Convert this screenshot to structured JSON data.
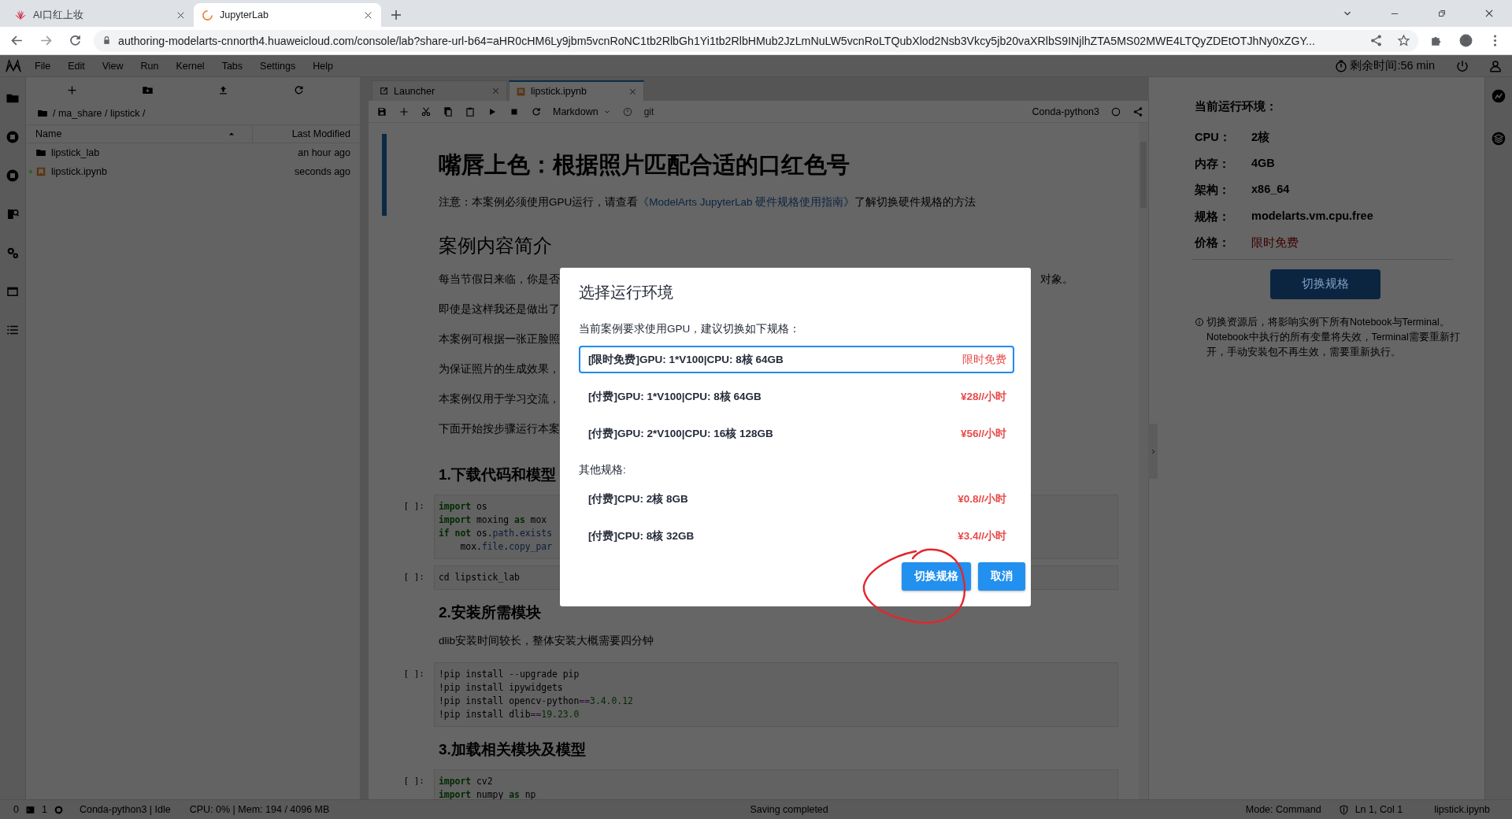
{
  "browser": {
    "tabs": [
      {
        "title": "AI口红上妆",
        "kind": "huawei",
        "selected": false
      },
      {
        "title": "JupyterLab",
        "kind": "loading",
        "selected": true
      }
    ],
    "url": "authoring-modelarts-cnnorth4.huaweicloud.com/console/lab?share-url-b64=aHR0cHM6Ly9jbm5vcnRoNC1tb2RlbGh1Yi1tb2RlbHMub2JzLmNuLW5vcnRoLTQubXlod2Nsb3Vkcy5jb20vaXRlbS9INjlhZTA5MS02MWE4LTQyZDEtOTJhNy0xZGY..."
  },
  "menu": [
    "File",
    "Edit",
    "View",
    "Run",
    "Kernel",
    "Tabs",
    "Settings",
    "Help"
  ],
  "timer": "剩余时间:56 min",
  "file_browser": {
    "path": "/ ma_share / lipstick /",
    "columns": [
      "Name",
      "Last Modified"
    ],
    "files": [
      {
        "name": "lipstick_lab",
        "kind": "folder",
        "modified": "an hour ago",
        "running": false
      },
      {
        "name": "lipstick.ipynb",
        "kind": "notebook",
        "modified": "seconds ago",
        "running": true
      }
    ]
  },
  "notebook": {
    "tabs": [
      {
        "label": "Launcher",
        "kind": "launcher",
        "selected": false
      },
      {
        "label": "lipstick.ipynb",
        "kind": "notebook",
        "selected": true
      }
    ],
    "cell_type": "Markdown",
    "git": "git",
    "kernel": "Conda-python3",
    "cells": [
      {
        "kind": "markdown",
        "active": true,
        "blocks": [
          {
            "kind": "h1",
            "text": "嘴唇上色：根据照片匹配合适的口红色号"
          },
          {
            "kind": "note",
            "text": "注意：本案例必须使用GPU运行，请查看",
            "link": "《ModelArts JupyterLab 硬件规格使用指南》",
            "after": "了解切换硬件规格的方法"
          }
        ]
      },
      {
        "kind": "markdown",
        "active": false,
        "blocks": [
          {
            "kind": "h2",
            "text": "案例内容简介"
          },
          {
            "kind": "p",
            "text": "每当节假日来临，你是否",
            "tail": "对象。"
          },
          {
            "kind": "p",
            "text": "即使是这样我还是做出了"
          },
          {
            "kind": "p",
            "text": "本案例可根据一张正脸照"
          },
          {
            "kind": "p",
            "text": "为保证照片的生成效果，"
          },
          {
            "kind": "p",
            "text": "本案例仅用于学习交流，"
          },
          {
            "kind": "p",
            "text": "下面开始按步骤运行本案"
          },
          {
            "kind": "h3",
            "text": "1.下载代码和模型"
          }
        ]
      },
      {
        "kind": "code",
        "active": false,
        "prompt": "[ ]:",
        "lines": [
          [
            {
              "kind": "keyword",
              "text": "import"
            },
            {
              "text": " os"
            }
          ],
          [
            {
              "kind": "keyword",
              "text": "import"
            },
            {
              "text": " moxing "
            },
            {
              "kind": "keyword",
              "text": "as"
            },
            {
              "text": " mox"
            }
          ],
          [
            {
              "kind": "keyword",
              "text": "if not"
            },
            {
              "text": " os."
            },
            {
              "kind": "attribute",
              "text": "path"
            },
            {
              "text": "."
            },
            {
              "kind": "attribute",
              "text": "exists"
            }
          ],
          [
            {
              "text": "    mox."
            },
            {
              "kind": "attribute",
              "text": "file"
            },
            {
              "text": "."
            },
            {
              "kind": "attribute",
              "text": "copy_par"
            }
          ]
        ]
      },
      {
        "kind": "code",
        "active": false,
        "prompt": "[ ]:",
        "lines": [
          [
            {
              "text": "cd lipstick_lab"
            }
          ]
        ]
      },
      {
        "kind": "markdown",
        "active": false,
        "blocks": [
          {
            "kind": "h3",
            "text": "2.安装所需模块"
          },
          {
            "kind": "p",
            "text": "dlib安装时间较长，整体安装大概需要四分钟"
          }
        ]
      },
      {
        "kind": "code",
        "active": false,
        "prompt": "[ ]:",
        "lines": [
          [
            {
              "text": "!pip install "
            },
            {
              "kind": "operator",
              "text": "--"
            },
            {
              "text": "upgrade pip"
            }
          ],
          [
            {
              "text": "!pip install ipywidgets"
            }
          ],
          [
            {
              "text": "!pip install opencv"
            },
            {
              "kind": "operator",
              "text": "-"
            },
            {
              "text": "python"
            },
            {
              "kind": "operator",
              "text": "=="
            },
            {
              "kind": "number",
              "text": "3.4.0.12"
            }
          ],
          [
            {
              "text": "!pip install dlib"
            },
            {
              "kind": "operator",
              "text": "=="
            },
            {
              "kind": "number",
              "text": "19.23.0"
            }
          ]
        ]
      },
      {
        "kind": "markdown",
        "active": false,
        "blocks": [
          {
            "kind": "h3",
            "text": "3.加载相关模块及模型"
          }
        ]
      },
      {
        "kind": "code",
        "active": false,
        "prompt": "[ ]:",
        "lines": [
          [
            {
              "kind": "keyword",
              "text": "import"
            },
            {
              "text": " cv2"
            }
          ],
          [
            {
              "kind": "keyword",
              "text": "import"
            },
            {
              "text": " numpy "
            },
            {
              "kind": "keyword",
              "text": "as"
            },
            {
              "text": " np"
            }
          ]
        ]
      }
    ]
  },
  "env_panel": {
    "title": "当前运行环境：",
    "specs": [
      {
        "label": "CPU：",
        "value": "2核",
        "kind": "plain"
      },
      {
        "label": "内存：",
        "value": "4GB",
        "kind": "plain"
      },
      {
        "label": "架构：",
        "value": "x86_64",
        "kind": "plain"
      },
      {
        "label": "规格：",
        "value": "modelarts.vm.cpu.free",
        "kind": "plain"
      },
      {
        "label": "价格：",
        "value": "限时免费",
        "kind": "price"
      }
    ],
    "button": "切换规格",
    "note": "切换资源后，将影响实例下所有Notebook与Terminal。Notebook中执行的所有变量将失效，Terminal需要重新打开，手动安装包不再生效，需要重新执行。"
  },
  "dialog": {
    "title": "选择运行环境",
    "sections": [
      {
        "label": "当前案例要求使用GPU，建议切换如下规格：",
        "options": [
          {
            "name": "[限时免费]GPU: 1*V100|CPU: 8核 64GB",
            "price": "限时免费",
            "selected": true
          },
          {
            "name": "[付费]GPU: 1*V100|CPU: 8核 64GB",
            "price": "¥28//小时",
            "selected": false
          },
          {
            "name": "[付费]GPU: 2*V100|CPU: 16核 128GB",
            "price": "¥56//小时",
            "selected": false
          }
        ]
      },
      {
        "label": "其他规格:",
        "options": [
          {
            "name": "[付费]CPU: 2核 8GB",
            "price": "¥0.8//小时",
            "selected": false
          },
          {
            "name": "[付费]CPU: 8核 32GB",
            "price": "¥3.4//小时",
            "selected": false
          }
        ]
      }
    ],
    "buttons": [
      "切换规格",
      "取消"
    ]
  },
  "annotation": {
    "kind": "circle"
  },
  "status_bar": {
    "terminals": "0",
    "kernels": "1",
    "kernel": "Conda-python3 | Idle",
    "resources": "CPU: 0% | Mem: 194 / 4096 MB",
    "message": "Saving completed",
    "mode": "Mode: Command",
    "position": "Ln 1, Col 1",
    "file": "lipstick.ipynb"
  }
}
